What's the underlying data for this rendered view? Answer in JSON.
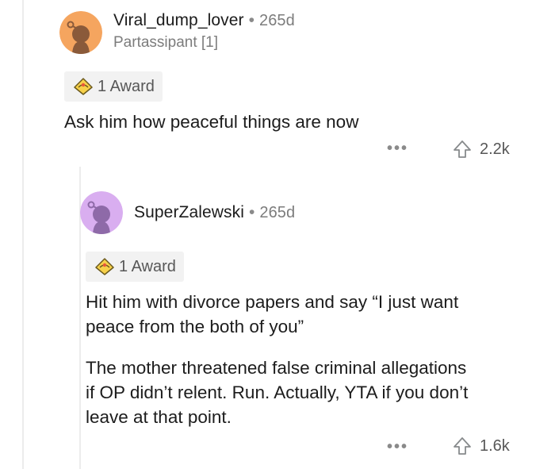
{
  "comment1": {
    "username": "Viral_dump_lover",
    "separator": "•",
    "age": "265d",
    "flair": "Partassipant [1]",
    "award_label": "1 Award",
    "body": "Ask him how peaceful things are now",
    "more_label": "•••",
    "score": "2.2k",
    "avatar_color": "#f5a55f"
  },
  "comment2": {
    "username": "SuperZalewski",
    "separator": "•",
    "age": "265d",
    "award_label": "1 Award",
    "paragraph1_line1": "Hit him with divorce papers and say “I just want",
    "paragraph1_line2": "peace from the both of you”",
    "paragraph2_line1": "The mother threatened false criminal allegations",
    "paragraph2_line2": "if OP didn’t relent. Run. Actually, YTA if you don’t",
    "paragraph2_line3": "leave at that point.",
    "more_label": "•••",
    "score": "1.6k",
    "avatar_color": "#d9aef0"
  }
}
